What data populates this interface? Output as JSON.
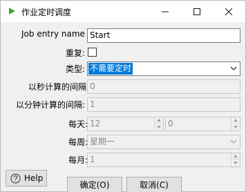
{
  "window": {
    "title": "作业定时调度",
    "controls": {
      "minimize": "minimize-icon",
      "maximize": "maximize-icon",
      "close": "close-icon"
    }
  },
  "form": {
    "job_entry_name": {
      "label": "Job entry name",
      "value": "Start"
    },
    "repeat": {
      "label": "重复:",
      "checked": false
    },
    "type": {
      "label": "类型:",
      "value": "不需要定时"
    },
    "interval_seconds": {
      "label": "以秒计算的间隔:",
      "value": "0"
    },
    "interval_minutes": {
      "label": "以分钟计算的间隔:",
      "value": "1"
    },
    "daily": {
      "label": "每天:",
      "hour": "12",
      "minute": "0"
    },
    "weekly": {
      "label": "每周:",
      "value": "星期一"
    },
    "monthly": {
      "label": "每月:",
      "value": "1"
    }
  },
  "buttons": {
    "help": "Help",
    "ok": "确定(O)",
    "cancel": "取消(C)"
  },
  "colors": {
    "accent": "#0078d7",
    "app_icon": "#3fa535"
  }
}
